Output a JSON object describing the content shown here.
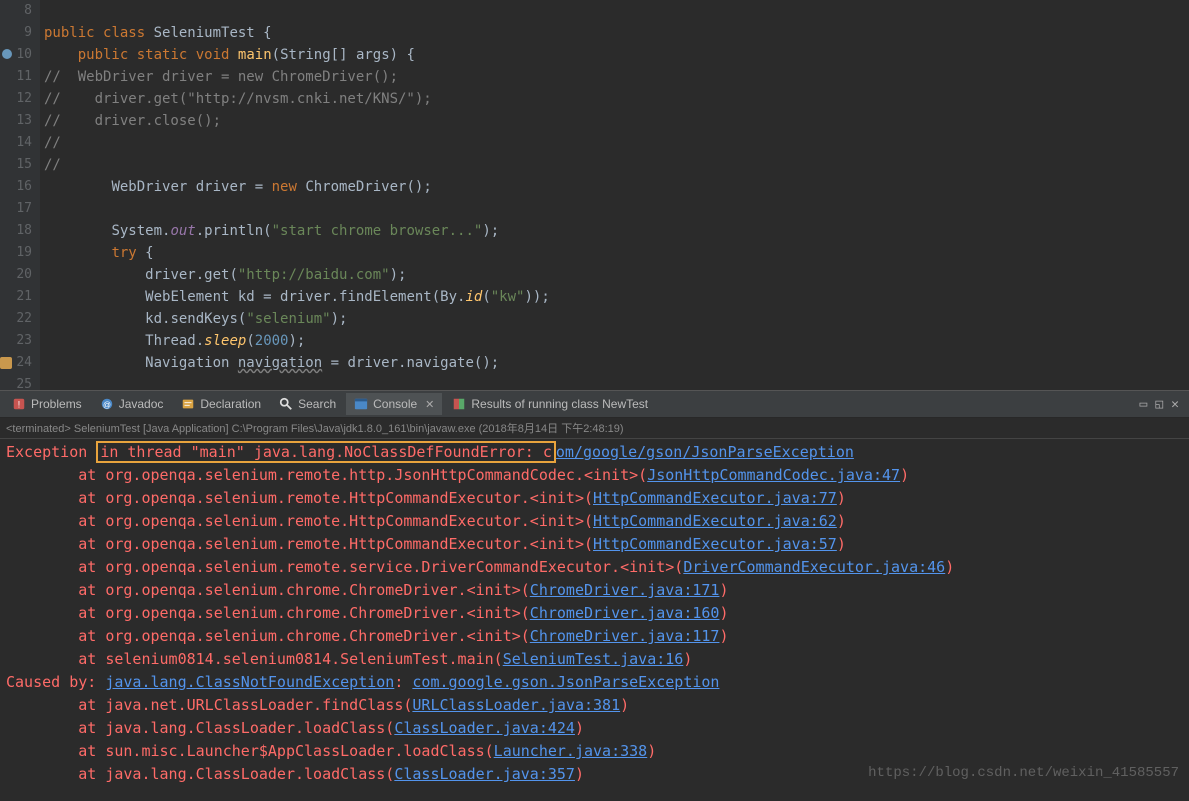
{
  "editor": {
    "startLine": 8,
    "lines": [
      {
        "n": 8,
        "tokens": []
      },
      {
        "n": 9,
        "tokens": [
          {
            "t": "public ",
            "c": "kw"
          },
          {
            "t": "class ",
            "c": "kw"
          },
          {
            "t": "SeleniumTest ",
            "c": "classname"
          },
          {
            "t": "{",
            "c": ""
          }
        ]
      },
      {
        "n": 10,
        "indent": "    ",
        "tokens": [
          {
            "t": "public ",
            "c": "kw"
          },
          {
            "t": "static ",
            "c": "kw"
          },
          {
            "t": "void ",
            "c": "kw"
          },
          {
            "t": "main",
            "c": "method"
          },
          {
            "t": "(",
            "c": ""
          },
          {
            "t": "String",
            "c": "classname"
          },
          {
            "t": "[] ",
            "c": ""
          },
          {
            "t": "args",
            "c": ""
          },
          {
            "t": ") {",
            "c": ""
          }
        ]
      },
      {
        "n": 11,
        "tokens": [
          {
            "t": "//  WebDriver driver = new ChromeDriver();",
            "c": "comment"
          }
        ]
      },
      {
        "n": 12,
        "tokens": [
          {
            "t": "//    driver.get(\"http://nvsm.cnki.net/KNS/\");",
            "c": "comment"
          }
        ]
      },
      {
        "n": 13,
        "tokens": [
          {
            "t": "//    driver.close();",
            "c": "comment"
          }
        ]
      },
      {
        "n": 14,
        "tokens": [
          {
            "t": "//",
            "c": "comment"
          }
        ]
      },
      {
        "n": 15,
        "tokens": [
          {
            "t": "//",
            "c": "comment"
          }
        ]
      },
      {
        "n": 16,
        "indent": "        ",
        "tokens": [
          {
            "t": "WebDriver ",
            "c": "classname"
          },
          {
            "t": "driver ",
            "c": ""
          },
          {
            "t": "= ",
            "c": ""
          },
          {
            "t": "new ",
            "c": "kw"
          },
          {
            "t": "ChromeDriver",
            "c": "classname"
          },
          {
            "t": "();",
            "c": ""
          }
        ]
      },
      {
        "n": 17,
        "tokens": []
      },
      {
        "n": 18,
        "indent": "        ",
        "tokens": [
          {
            "t": "System",
            "c": "classname"
          },
          {
            "t": ".",
            "c": ""
          },
          {
            "t": "out",
            "c": "staticfield"
          },
          {
            "t": ".println(",
            "c": ""
          },
          {
            "t": "\"start chrome browser...\"",
            "c": "str"
          },
          {
            "t": ");",
            "c": ""
          }
        ]
      },
      {
        "n": 19,
        "indent": "        ",
        "tokens": [
          {
            "t": "try ",
            "c": "kw"
          },
          {
            "t": "{",
            "c": ""
          }
        ]
      },
      {
        "n": 20,
        "indent": "            ",
        "tokens": [
          {
            "t": "driver.get(",
            "c": ""
          },
          {
            "t": "\"http://baidu.com\"",
            "c": "str"
          },
          {
            "t": ");",
            "c": ""
          }
        ]
      },
      {
        "n": 21,
        "indent": "            ",
        "tokens": [
          {
            "t": "WebElement ",
            "c": "classname"
          },
          {
            "t": "kd = driver.findElement(By.",
            "c": ""
          },
          {
            "t": "id",
            "c": "staticmethod"
          },
          {
            "t": "(",
            "c": ""
          },
          {
            "t": "\"kw\"",
            "c": "str"
          },
          {
            "t": "));",
            "c": ""
          }
        ]
      },
      {
        "n": 22,
        "indent": "            ",
        "tokens": [
          {
            "t": "kd.sendKeys(",
            "c": ""
          },
          {
            "t": "\"selenium\"",
            "c": "str"
          },
          {
            "t": ");",
            "c": ""
          }
        ]
      },
      {
        "n": 23,
        "indent": "            ",
        "tokens": [
          {
            "t": "Thread",
            "c": "classname"
          },
          {
            "t": ".",
            "c": ""
          },
          {
            "t": "sleep",
            "c": "staticmethod"
          },
          {
            "t": "(",
            "c": ""
          },
          {
            "t": "2000",
            "c": "num"
          },
          {
            "t": ");",
            "c": ""
          }
        ]
      },
      {
        "n": 24,
        "indent": "            ",
        "tokens": [
          {
            "t": "Navigation ",
            "c": "classname"
          },
          {
            "t": "navigation",
            "c": "wavy"
          },
          {
            "t": " = driver.navigate();",
            "c": ""
          }
        ]
      },
      {
        "n": 25,
        "tokens": []
      }
    ]
  },
  "tabs": {
    "items": [
      {
        "icon": "problems",
        "label": "Problems"
      },
      {
        "icon": "javadoc",
        "label": "Javadoc"
      },
      {
        "icon": "declaration",
        "label": "Declaration"
      },
      {
        "icon": "search",
        "label": "Search"
      },
      {
        "icon": "console",
        "label": "Console",
        "active": true,
        "closable": true
      },
      {
        "icon": "results",
        "label": "Results of running class NewTest"
      }
    ]
  },
  "terminated": "<terminated> SeleniumTest [Java Application] C:\\Program Files\\Java\\jdk1.8.0_161\\bin\\javaw.exe (2018年8月14日 下午2:48:19)",
  "console": {
    "lines": [
      {
        "segments": [
          {
            "t": "Exception",
            "c": "err"
          },
          {
            "t": " ",
            "c": ""
          },
          {
            "t": "in thread \"main\" java.lang.NoClassDefFoundError: c",
            "c": "err",
            "box": true
          },
          {
            "t": "om/google/gson/JsonParseException",
            "c": "err-link"
          }
        ]
      },
      {
        "segments": [
          {
            "t": "        at org.openqa.selenium.remote.http.JsonHttpCommandCodec.<init>(",
            "c": "err"
          },
          {
            "t": "JsonHttpCommandCodec.java:47",
            "c": "err-link"
          },
          {
            "t": ")",
            "c": "err"
          }
        ]
      },
      {
        "segments": [
          {
            "t": "        at org.openqa.selenium.remote.HttpCommandExecutor.<init>(",
            "c": "err"
          },
          {
            "t": "HttpCommandExecutor.java:77",
            "c": "err-link"
          },
          {
            "t": ")",
            "c": "err"
          }
        ]
      },
      {
        "segments": [
          {
            "t": "        at org.openqa.selenium.remote.HttpCommandExecutor.<init>(",
            "c": "err"
          },
          {
            "t": "HttpCommandExecutor.java:62",
            "c": "err-link"
          },
          {
            "t": ")",
            "c": "err"
          }
        ]
      },
      {
        "segments": [
          {
            "t": "        at org.openqa.selenium.remote.HttpCommandExecutor.<init>(",
            "c": "err"
          },
          {
            "t": "HttpCommandExecutor.java:57",
            "c": "err-link"
          },
          {
            "t": ")",
            "c": "err"
          }
        ]
      },
      {
        "segments": [
          {
            "t": "        at org.openqa.selenium.remote.service.DriverCommandExecutor.<init>(",
            "c": "err"
          },
          {
            "t": "DriverCommandExecutor.java:46",
            "c": "err-link"
          },
          {
            "t": ")",
            "c": "err"
          }
        ]
      },
      {
        "segments": [
          {
            "t": "        at org.openqa.selenium.chrome.ChromeDriver.<init>(",
            "c": "err"
          },
          {
            "t": "ChromeDriver.java:171",
            "c": "err-link"
          },
          {
            "t": ")",
            "c": "err"
          }
        ]
      },
      {
        "segments": [
          {
            "t": "        at org.openqa.selenium.chrome.ChromeDriver.<init>(",
            "c": "err"
          },
          {
            "t": "ChromeDriver.java:160",
            "c": "err-link"
          },
          {
            "t": ")",
            "c": "err"
          }
        ]
      },
      {
        "segments": [
          {
            "t": "        at org.openqa.selenium.chrome.ChromeDriver.<init>(",
            "c": "err"
          },
          {
            "t": "ChromeDriver.java:117",
            "c": "err-link"
          },
          {
            "t": ")",
            "c": "err"
          }
        ]
      },
      {
        "segments": [
          {
            "t": "        at selenium0814.selenium0814.SeleniumTest.main(",
            "c": "err"
          },
          {
            "t": "SeleniumTest.java:16",
            "c": "err-link"
          },
          {
            "t": ")",
            "c": "err"
          }
        ]
      },
      {
        "segments": [
          {
            "t": "Caused by: ",
            "c": "err"
          },
          {
            "t": "java.lang.ClassNotFoundException",
            "c": "err-link"
          },
          {
            "t": ": ",
            "c": "err"
          },
          {
            "t": "com.google.gson.JsonParseException",
            "c": "err-link"
          }
        ]
      },
      {
        "segments": [
          {
            "t": "        at java.net.URLClassLoader.findClass(",
            "c": "err"
          },
          {
            "t": "URLClassLoader.java:381",
            "c": "err-link"
          },
          {
            "t": ")",
            "c": "err"
          }
        ]
      },
      {
        "segments": [
          {
            "t": "        at java.lang.ClassLoader.loadClass(",
            "c": "err"
          },
          {
            "t": "ClassLoader.java:424",
            "c": "err-link"
          },
          {
            "t": ")",
            "c": "err"
          }
        ]
      },
      {
        "segments": [
          {
            "t": "        at sun.misc.Launcher$AppClassLoader.loadClass(",
            "c": "err"
          },
          {
            "t": "Launcher.java:338",
            "c": "err-link"
          },
          {
            "t": ")",
            "c": "err"
          }
        ]
      },
      {
        "segments": [
          {
            "t": "        at java.lang.ClassLoader.loadClass(",
            "c": "err"
          },
          {
            "t": "ClassLoader.java:357",
            "c": "err-link"
          },
          {
            "t": ")",
            "c": "err"
          }
        ]
      }
    ]
  },
  "watermark": "https://blog.csdn.net/weixin_41585557"
}
